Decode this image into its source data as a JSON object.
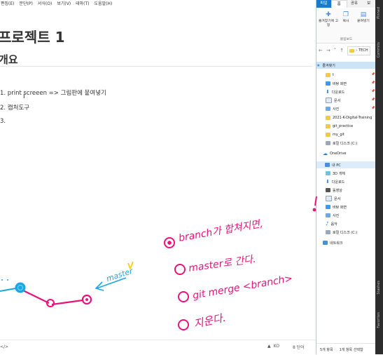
{
  "editor": {
    "menu": [
      "편집(E)",
      "문단(P)",
      "서식(O)",
      "보기(V)",
      "테마(T)",
      "도움말(H)"
    ],
    "heading1": "프로젝트 1",
    "heading2": "개요",
    "list": [
      "1. print screeen => 그림판에 붙여넣기",
      "2. 캡처도구",
      "3."
    ],
    "status": {
      "left": "</>",
      "lang": "KO",
      "words": "8 단어"
    }
  },
  "explorer": {
    "tabs": [
      "파일",
      "홈",
      "공유",
      "보"
    ],
    "ribbon": {
      "pin": "즐겨찾기에 고정",
      "copy": "복사",
      "paste": "붙여넣기",
      "group": "클립보드"
    },
    "address": "TECH",
    "tree": {
      "quick_access": "즐겨찾기",
      "qa_items": [
        "t",
        "바탕 화면",
        "다운로드",
        "문서",
        "사진",
        "2021-K-Digital-Training",
        "git_practice",
        "my_git",
        "로컬 디스크 (C:)"
      ],
      "onedrive": "OneDrive",
      "this_pc": "내 PC",
      "pc_items": [
        "3D 개체",
        "다운로드",
        "동영상",
        "문서",
        "바탕 화면",
        "사진",
        "음악",
        "로컬 디스크 (C:)"
      ],
      "network": "네트워크"
    },
    "status": [
      "5개 항목",
      "1개 항목 선택함"
    ]
  },
  "strip_labels": [
    "Pinned",
    "Commits",
    "Stashes",
    "Favorites"
  ],
  "annotation": {
    "line1": "branch가 합쳐지면,",
    "line2": "master로 간다.",
    "line3": "git merge <branch>",
    "line4": "지운다.",
    "master_label": "master"
  },
  "colors": {
    "accent": "#1979ca",
    "ink": "#e8127c",
    "graph_cyan": "#1aa7e6",
    "arrow_blue": "#1aa7e6",
    "yellow": "#f6d21a"
  }
}
